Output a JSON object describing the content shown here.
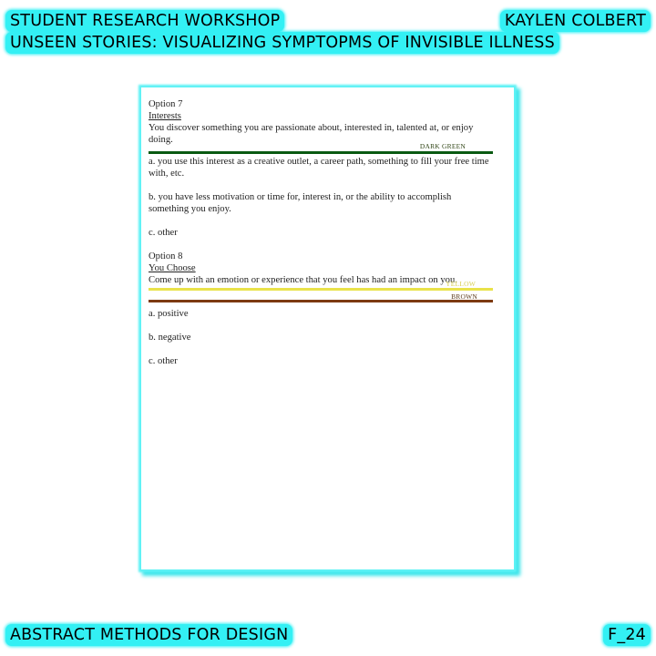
{
  "header": {
    "workshop": "STUDENT RESEARCH WORKSHOP",
    "title": "UNSEEN STORIES: VISUALIZING SYMPTOPMS OF INVISIBLE ILLNESS",
    "author": "KAYLEN COLBERT"
  },
  "footer": {
    "course": "ABSTRACT METHODS FOR DESIGN",
    "page": "F_24"
  },
  "document": {
    "option7": {
      "heading": "Option 7",
      "subtitle": "Interests",
      "prompt": "You discover something you are passionate about, interested in, talented at, or enjoy doing.",
      "color_label": "DARK GREEN",
      "a": "a. you use this interest as a creative outlet, a career path, something to fill your free time with, etc.",
      "b": "b. you have less motivation or time for,  interest in, or the ability to accomplish something you enjoy.",
      "c": "c. other"
    },
    "option8": {
      "heading": "Option 8",
      "subtitle": "You Choose",
      "prompt": "Come up with an emotion or experience that you feel has had an impact on you.",
      "color_label_1": "YELLOW",
      "color_label_2": "BROWN",
      "a": "a. positive",
      "b": "b. negative",
      "c": "c. other"
    }
  },
  "colors": {
    "tag_background": "#33f0f4",
    "dark_green": "#0a5a12",
    "yellow": "#e9e24a",
    "brown": "#7d3a12"
  }
}
